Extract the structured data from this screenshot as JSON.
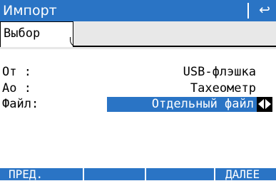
{
  "window": {
    "title": "Импорт",
    "back_icon": "↩"
  },
  "tabs": [
    {
      "label": "Выбор",
      "active": true
    }
  ],
  "fields": [
    {
      "label": "От :",
      "value": "USB-флэшка"
    },
    {
      "label": "Ао :",
      "value": "Тахеометр"
    },
    {
      "label": "Файл:",
      "value": "Отдельный файл"
    }
  ],
  "softkeys": {
    "prev": "ПРЕД.",
    "next": "ДАЛЕЕ"
  },
  "colors": {
    "accent": "#2a74c5",
    "tab_strip": "#e8e8e8"
  }
}
